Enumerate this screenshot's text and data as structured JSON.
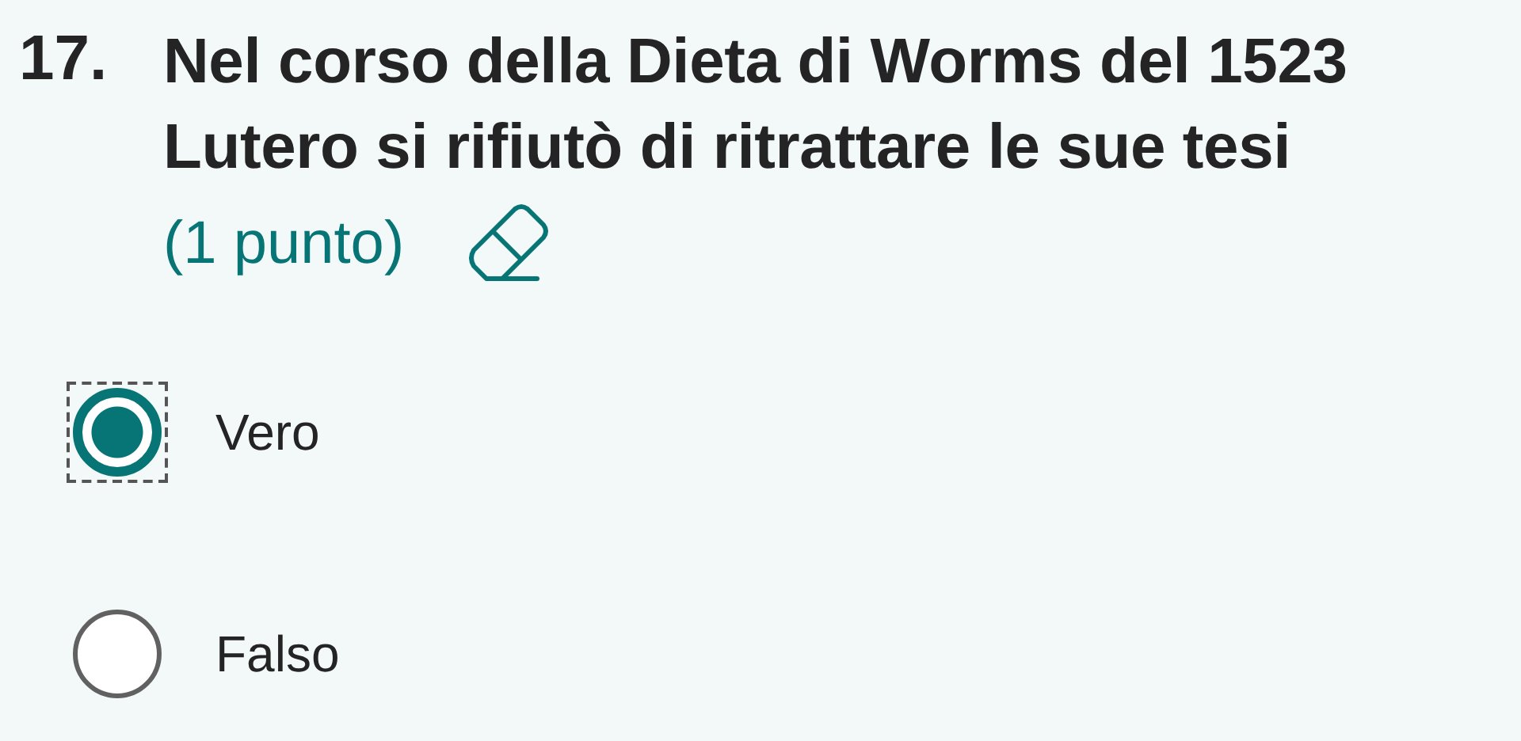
{
  "question": {
    "number": "17.",
    "lines": [
      "Nel corso della Dieta di Worms del 1523",
      "Lutero si rifiutò di ritrattare le sue tesi"
    ],
    "points": "(1 punto)"
  },
  "options": [
    {
      "label": "Vero",
      "selected": true
    },
    {
      "label": "Falso",
      "selected": false
    }
  ]
}
